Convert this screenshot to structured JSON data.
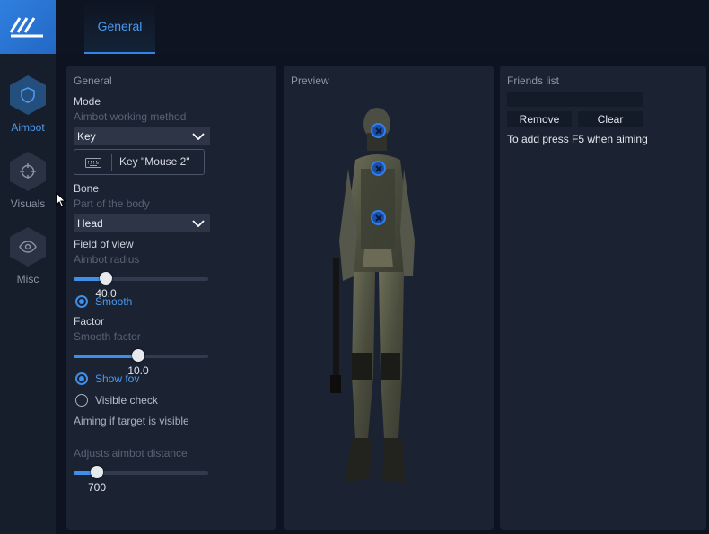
{
  "app": {
    "tabs": [
      {
        "label": "General"
      }
    ],
    "sidebar": {
      "items": [
        {
          "label": "Aimbot",
          "icon": "shield-icon",
          "active": true
        },
        {
          "label": "Visuals",
          "icon": "crosshair-icon",
          "active": false
        },
        {
          "label": "Misc",
          "icon": "eye-icon",
          "active": false
        }
      ]
    }
  },
  "general": {
    "title": "General",
    "mode": {
      "label": "Mode",
      "sub": "Aimbot working method",
      "value": "Key"
    },
    "key_button": {
      "label": "Key \"Mouse 2\""
    },
    "bone": {
      "label": "Bone",
      "sub": "Part of the body",
      "value": "Head"
    },
    "fov": {
      "label": "Field of view",
      "sub": "Aimbot radius",
      "value": "40.0",
      "fraction": 0.24
    },
    "smooth": {
      "label": "Smooth",
      "checked": true
    },
    "factor": {
      "label": "Factor",
      "sub": "Smooth factor",
      "value": "10.0",
      "fraction": 0.48
    },
    "show_fov": {
      "label": "Show fov",
      "checked": true
    },
    "visible_check": {
      "label": "Visible check",
      "checked": false,
      "hint": "Aiming if target is visible"
    },
    "distance": {
      "sub": "Adjusts aimbot distance",
      "value": "700",
      "fraction": 0.17
    }
  },
  "preview": {
    "title": "Preview"
  },
  "friends": {
    "title": "Friends list",
    "input_value": "",
    "remove_label": "Remove",
    "clear_label": "Clear",
    "hint": "To add press F5 when aiming"
  },
  "colors": {
    "accent": "#3f8fe8",
    "background": "#0d1320",
    "panel": "#1b2232"
  }
}
